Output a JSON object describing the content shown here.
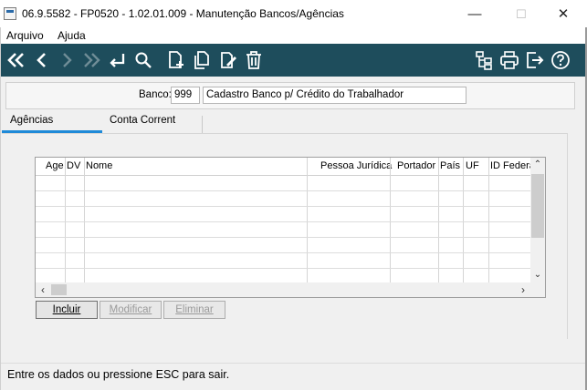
{
  "window": {
    "title": "06.9.5582 - FP0520 - 1.02.01.009 - Manutenção Bancos/Agências",
    "minimize": "—",
    "maximize": "☐",
    "close": "✕"
  },
  "menu": {
    "items": [
      "Arquivo",
      "Ajuda"
    ]
  },
  "toolbar": {
    "background": "#1e4d5c",
    "left_icons": [
      "first-record-icon",
      "previous-record-icon",
      "next-record-icon",
      "last-record-icon",
      "return-icon",
      "search-icon",
      "new-record-icon",
      "copy-record-icon",
      "edit-record-icon",
      "delete-icon"
    ],
    "right_icons": [
      "hierarchy-icon",
      "print-icon",
      "exit-icon",
      "help-icon"
    ]
  },
  "bank": {
    "label": "Banco:",
    "code": "999",
    "name": "Cadastro Banco p/ Crédito do Trabalhador"
  },
  "tabs": {
    "agencias": "Agências",
    "conta_corrente": "Conta Corrent",
    "active": "Agências",
    "accent": "#1f8ad8"
  },
  "grid": {
    "columns": [
      "Age",
      "DV",
      "Nome",
      "Pessoa Jurídica",
      "Portador",
      "País",
      "UF",
      "ID Federa"
    ],
    "rows": []
  },
  "buttons": {
    "incluir": "Incluir",
    "modificar": "Modificar",
    "eliminar": "Eliminar"
  },
  "status": {
    "text": "Entre os dados ou pressione ESC para sair."
  }
}
